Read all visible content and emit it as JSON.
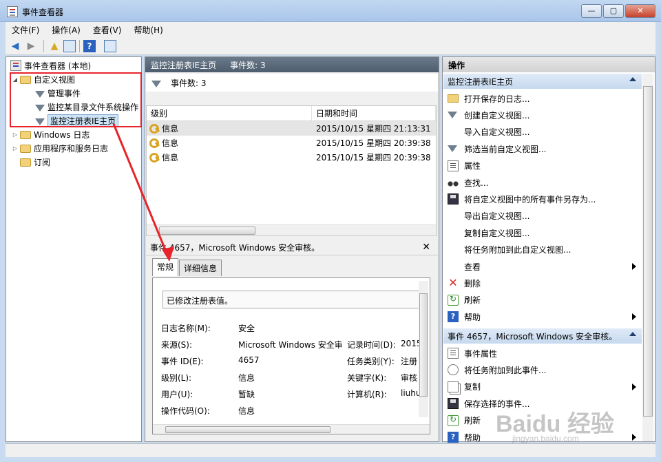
{
  "window": {
    "title": "事件查看器"
  },
  "menu": [
    "文件(F)",
    "操作(A)",
    "查看(V)",
    "帮助(H)"
  ],
  "tree": {
    "root": "事件查看器 (本地)",
    "custom_views": "自定义视图",
    "admin_events": "管理事件",
    "monitor_dir": "监控某目录文件系统操作",
    "monitor_reg": "监控注册表IE主页",
    "windows_logs": "Windows 日志",
    "app_service_logs": "应用程序和服务日志",
    "subscriptions": "订阅"
  },
  "center": {
    "header_title": "监控注册表IE主页",
    "header_count": "事件数: 3",
    "filter_count": "事件数: 3",
    "columns": [
      "级别",
      "日期和时间"
    ],
    "rows": [
      {
        "level": "信息",
        "datetime": "2015/10/15 星期四 21:13:31"
      },
      {
        "level": "信息",
        "datetime": "2015/10/15 星期四 20:39:38"
      },
      {
        "level": "信息",
        "datetime": "2015/10/15 星期四 20:39:38"
      }
    ],
    "detail_title": "事件 4657，Microsoft Windows 安全审核。",
    "tabs": [
      "常规",
      "详细信息"
    ],
    "description": "已修改注册表值。",
    "props": {
      "log_name_label": "日志名称(M):",
      "log_name": "安全",
      "source_label": "来源(S):",
      "source": "Microsoft Windows 安全审",
      "logged_label": "记录时间(D):",
      "logged": "2015",
      "event_id_label": "事件 ID(E):",
      "event_id": "4657",
      "task_label": "任务类别(Y):",
      "task": "注册",
      "level_label": "级别(L):",
      "level": "信息",
      "keywords_label": "关键字(K):",
      "keywords": "审核",
      "user_label": "用户(U):",
      "user": "暂缺",
      "computer_label": "计算机(R):",
      "computer": "liuhu",
      "opcode_label": "操作代码(O):",
      "opcode": "信息"
    }
  },
  "actions": {
    "header": "操作",
    "section1": "监控注册表IE主页",
    "items1": [
      {
        "label": "打开保存的日志...",
        "icon": "open-folder-icon"
      },
      {
        "label": "创建自定义视图...",
        "icon": "filter-icon"
      },
      {
        "label": "导入自定义视图...",
        "icon": "blank"
      },
      {
        "label": "筛选当前自定义视图...",
        "icon": "filter-icon"
      },
      {
        "label": "属性",
        "icon": "properties-icon"
      },
      {
        "label": "查找...",
        "icon": "binoculars-icon"
      },
      {
        "label": "将自定义视图中的所有事件另存为...",
        "icon": "save-icon"
      },
      {
        "label": "导出自定义视图...",
        "icon": "blank"
      },
      {
        "label": "复制自定义视图...",
        "icon": "blank"
      },
      {
        "label": "将任务附加到此自定义视图...",
        "icon": "blank"
      },
      {
        "label": "查看",
        "icon": "blank"
      },
      {
        "label": "删除",
        "icon": "delete-icon"
      },
      {
        "label": "刷新",
        "icon": "refresh-icon"
      },
      {
        "label": "帮助",
        "icon": "help-icon"
      }
    ],
    "section2": "事件 4657，Microsoft Windows 安全审核。",
    "items2": [
      {
        "label": "事件属性",
        "icon": "properties-icon"
      },
      {
        "label": "将任务附加到此事件...",
        "icon": "task-icon"
      },
      {
        "label": "复制",
        "icon": "copy-icon"
      },
      {
        "label": "保存选择的事件...",
        "icon": "save-icon"
      },
      {
        "label": "刷新",
        "icon": "refresh-icon"
      },
      {
        "label": "帮助",
        "icon": "help-icon"
      }
    ]
  },
  "watermark": {
    "text": "Baidu 经验",
    "sub": "jingyan.baidu.com"
  },
  "colors": {
    "highlight_box": "#e8232a",
    "section_blue": "#c6d9ef"
  }
}
